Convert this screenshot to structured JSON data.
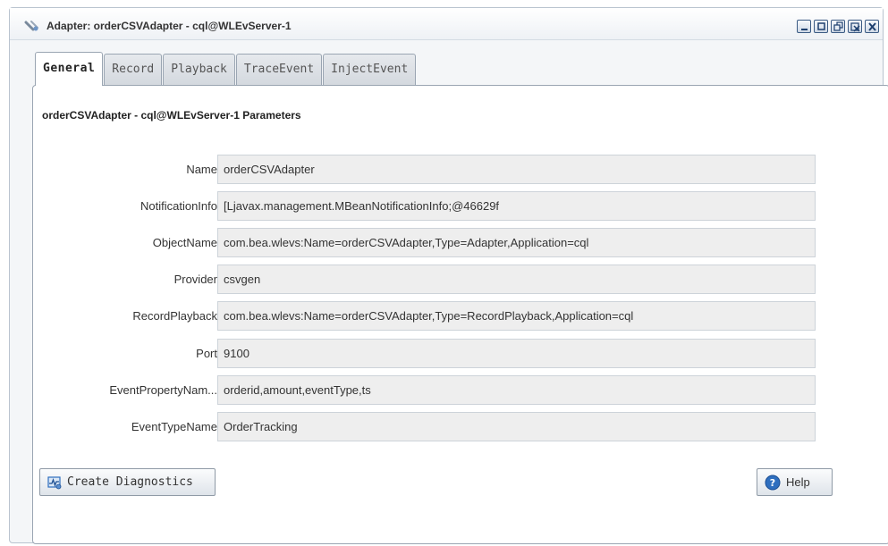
{
  "window": {
    "title": "Adapter: orderCSVAdapter - cql@WLEvServer-1",
    "buttons": [
      "minimize-icon",
      "maximize-icon",
      "restore-icon",
      "pin-icon",
      "close-icon"
    ]
  },
  "tabs": [
    {
      "label": "General",
      "active": true
    },
    {
      "label": "Record",
      "active": false
    },
    {
      "label": "Playback",
      "active": false
    },
    {
      "label": "TraceEvent",
      "active": false
    },
    {
      "label": "InjectEvent",
      "active": false
    }
  ],
  "panel": {
    "heading": "orderCSVAdapter - cql@WLEvServer-1 Parameters"
  },
  "fields": [
    {
      "label": "Name",
      "value": "orderCSVAdapter"
    },
    {
      "label": "NotificationInfo",
      "value": "[Ljavax.management.MBeanNotificationInfo;@46629f"
    },
    {
      "label": "ObjectName",
      "value": "com.bea.wlevs:Name=orderCSVAdapter,Type=Adapter,Application=cql"
    },
    {
      "label": "Provider",
      "value": "csvgen"
    },
    {
      "label": "RecordPlayback",
      "value": "com.bea.wlevs:Name=orderCSVAdapter,Type=RecordPlayback,Application=cql"
    },
    {
      "label": "Port",
      "value": "9100"
    },
    {
      "label": "EventPropertyNam...",
      "value": "orderid,amount,eventType,ts"
    },
    {
      "label": "EventTypeName",
      "value": "OrderTracking"
    }
  ],
  "actions": {
    "create_diagnostics": "Create Diagnostics",
    "help": "Help"
  },
  "colors": {
    "accent_blue": "#2f6fbf",
    "window_button_border": "#3a5a83",
    "field_background": "#eeeeee"
  }
}
